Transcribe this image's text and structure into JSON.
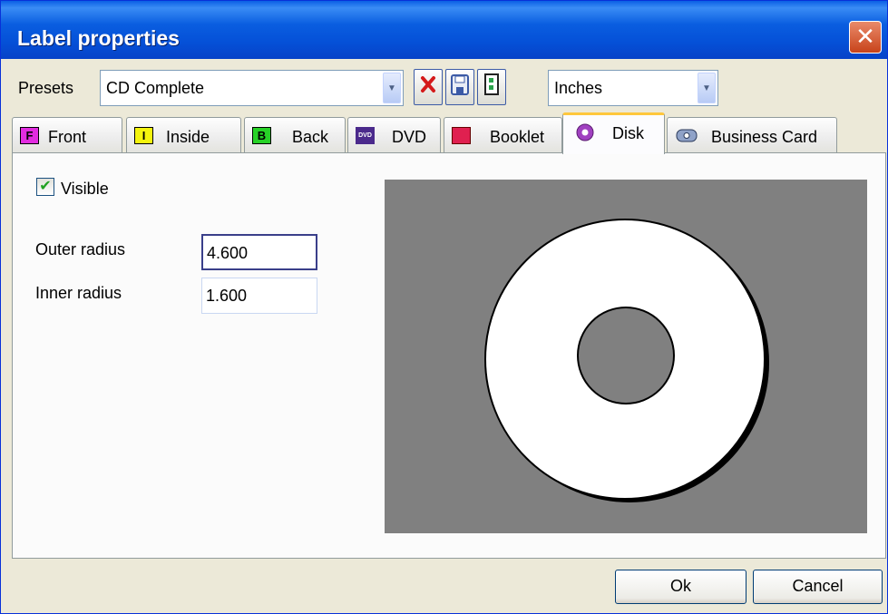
{
  "window": {
    "title": "Label properties",
    "close_glyph": "✕"
  },
  "toolbar": {
    "presets_label": "Presets",
    "preset_value": "CD Complete",
    "units_value": "Inches",
    "buttons": {
      "delete_icon": "delete-icon",
      "save_icon": "save-icon",
      "clipboard_icon": "clipboard-icon"
    }
  },
  "tabs": [
    {
      "label": "Front",
      "icon_text": "F",
      "icon_bg": "#e22ce0"
    },
    {
      "label": "Inside",
      "icon_text": "I",
      "icon_bg": "#f4f40e"
    },
    {
      "label": "Back",
      "icon_text": "B",
      "icon_bg": "#27d227"
    },
    {
      "label": "DVD",
      "icon_text": "DVD",
      "icon_bg": "#4b2a8c"
    },
    {
      "label": "Booklet",
      "icon_text": "",
      "icon_bg": "#e02050"
    },
    {
      "label": "Disk",
      "icon_text": "",
      "icon_bg": "#a040c0",
      "active": true
    },
    {
      "label": "Business Card",
      "icon_text": "",
      "icon_bg": "#6a7fa8"
    }
  ],
  "disk": {
    "visible_label": "Visible",
    "visible_checked": true,
    "outer_label": "Outer radius",
    "outer_value": "4.600",
    "inner_label": "Inner radius",
    "inner_value": "1.600"
  },
  "footer": {
    "ok_label": "Ok",
    "cancel_label": "Cancel"
  }
}
